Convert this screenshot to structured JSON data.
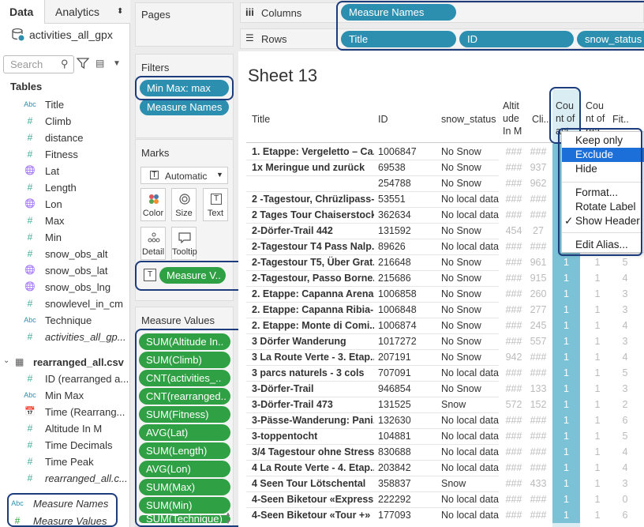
{
  "data_pane": {
    "tabs": [
      {
        "label": "Data"
      },
      {
        "label": "Analytics"
      }
    ],
    "datasource": "activities_all_gpx",
    "search_placeholder": "Search",
    "tables_heading": "Tables",
    "fields1": [
      {
        "icon": "Abc",
        "label": "Title"
      },
      {
        "icon": "#",
        "label": "Climb"
      },
      {
        "icon": "#",
        "label": "distance"
      },
      {
        "icon": "#",
        "label": "Fitness"
      },
      {
        "icon": "globe",
        "label": "Lat"
      },
      {
        "icon": "#",
        "label": "Length"
      },
      {
        "icon": "globe",
        "label": "Lon"
      },
      {
        "icon": "#",
        "label": "Max"
      },
      {
        "icon": "#",
        "label": "Min"
      },
      {
        "icon": "#",
        "label": "snow_obs_alt"
      },
      {
        "icon": "globe",
        "label": "snow_obs_lat"
      },
      {
        "icon": "globe",
        "label": "snow_obs_lng"
      },
      {
        "icon": "#",
        "label": "snowlevel_in_cm"
      },
      {
        "icon": "Abc",
        "label": "Technique"
      },
      {
        "icon": "#",
        "label": "activities_all_gp..."
      }
    ],
    "table2": "rearranged_all.csv",
    "fields2": [
      {
        "icon": "#",
        "label": "ID (rearranged a..."
      },
      {
        "icon": "Abc",
        "label": "Min Max"
      },
      {
        "icon": "cal",
        "label": "Time (Rearrang..."
      },
      {
        "icon": "#",
        "label": "Altitude In M"
      },
      {
        "icon": "#",
        "label": "Time Decimals"
      },
      {
        "icon": "#",
        "label": "Time Peak"
      },
      {
        "icon": "#",
        "label": "rearranged_all.c..."
      }
    ],
    "measure_names": "Measure Names",
    "measure_values": "Measure Values"
  },
  "pages_title": "Pages",
  "filters": {
    "title": "Filters",
    "pills": [
      "Min Max: max",
      "Measure Names"
    ]
  },
  "marks": {
    "title": "Marks",
    "type": "Automatic",
    "buttons": [
      {
        "label": "Color"
      },
      {
        "label": "Size"
      },
      {
        "label": "Text"
      },
      {
        "label": "Detail"
      },
      {
        "label": "Tooltip"
      }
    ],
    "pill": "Measure V.."
  },
  "measure_values": {
    "title": "Measure Values",
    "pills": [
      "SUM(Altitude In..",
      "SUM(Climb)",
      "CNT(activities_..",
      "CNT(rearranged..",
      "SUM(Fitness)",
      "AVG(Lat)",
      "SUM(Length)",
      "AVG(Lon)",
      "SUM(Max)",
      "SUM(Min)",
      "SUM(Technique)"
    ]
  },
  "shelves": {
    "columns_label": "Columns",
    "rows_label": "Rows",
    "columns_pills": [
      "Measure Names"
    ],
    "rows_pills": [
      "Title",
      "ID",
      "snow_status"
    ]
  },
  "sheet": {
    "title": "Sheet 13",
    "headers": [
      "Title",
      "ID",
      "snow_status",
      "Altit ude In M",
      "Cli..",
      "Cou nt of act",
      "Cou nt of rea",
      "Fit.."
    ],
    "rows": [
      [
        "1. Etappe: Vergeletto – Ca..",
        "1006847",
        "No Snow",
        "###",
        "###",
        "1",
        "",
        ""
      ],
      [
        "1x Meringue und zurück",
        "69538",
        "No Snow",
        "###",
        "937",
        "1",
        "",
        ""
      ],
      [
        "",
        "254788",
        "No Snow",
        "###",
        "962",
        "1",
        "",
        ""
      ],
      [
        "2 -Tagestour, Chrüzlipass-..",
        "53551",
        "No local data",
        "###",
        "###",
        "1",
        "",
        ""
      ],
      [
        "2 Tages Tour Chaiserstock",
        "362634",
        "No local data",
        "###",
        "###",
        "1",
        "",
        ""
      ],
      [
        "2-Dörfer-Trail 442",
        "131592",
        "No Snow",
        "454",
        "27",
        "1",
        "",
        ""
      ],
      [
        "2-Tagestour T4 Pass Nalp..",
        "89626",
        "No local data",
        "###",
        "###",
        "1",
        "",
        ""
      ],
      [
        "2-Tagestour T5, Über Grat..",
        "216648",
        "No Snow",
        "###",
        "961",
        "1",
        "1",
        "5"
      ],
      [
        "2-Tagestour,  Passo Borne..",
        "215686",
        "No Snow",
        "###",
        "915",
        "1",
        "1",
        "4"
      ],
      [
        "2. Etappe: Capanna Arena..",
        "1006858",
        "No Snow",
        "###",
        "260",
        "1",
        "1",
        "3"
      ],
      [
        "2. Etappe: Capanna Ribia-..",
        "1006848",
        "No Snow",
        "###",
        "277",
        "1",
        "1",
        "3"
      ],
      [
        "2. Etappe: Monte di Comi..",
        "1006874",
        "No Snow",
        "###",
        "245",
        "1",
        "1",
        "4"
      ],
      [
        "3 Dörfer Wanderung",
        "1017272",
        "No Snow",
        "###",
        "557",
        "1",
        "1",
        "3"
      ],
      [
        "3 La Route Verte - 3. Etap..",
        "207191",
        "No Snow",
        "942",
        "###",
        "1",
        "1",
        "4"
      ],
      [
        "3 parcs naturels - 3 cols",
        "707091",
        "No local data",
        "###",
        "###",
        "1",
        "1",
        "5"
      ],
      [
        "3-Dörfer-Trail",
        "946854",
        "No Snow",
        "###",
        "133",
        "1",
        "1",
        "3"
      ],
      [
        "3-Dörfer-Trail 473",
        "131525",
        "Snow",
        "572",
        "152",
        "1",
        "1",
        "2"
      ],
      [
        "3-Pässe-Wanderung: Pani..",
        "132630",
        "No local data",
        "###",
        "###",
        "1",
        "1",
        "6"
      ],
      [
        "3-toppentocht",
        "104881",
        "No local data",
        "###",
        "###",
        "1",
        "1",
        "5"
      ],
      [
        "3/4 Tagestour ohne Stress",
        "830688",
        "No local data",
        "###",
        "###",
        "1",
        "1",
        "4"
      ],
      [
        "4 La Route Verte - 4. Etap..",
        "203842",
        "No local data",
        "###",
        "###",
        "1",
        "1",
        "4"
      ],
      [
        "4 Seen Tour Lötschental",
        "358837",
        "Snow",
        "###",
        "433",
        "1",
        "1",
        "3"
      ],
      [
        "4-Seen Biketour «Express»",
        "222292",
        "No local data",
        "###",
        "###",
        "1",
        "1",
        "0"
      ],
      [
        "4-Seen Biketour «Tour +»",
        "177093",
        "No local data",
        "###",
        "###",
        "1",
        "1",
        "6"
      ]
    ]
  },
  "context_menu": {
    "items": [
      "Keep only",
      "Exclude",
      "Hide",
      "Format...",
      "Rotate Label",
      "Show Header",
      "Edit Alias..."
    ],
    "checked": "✓"
  }
}
